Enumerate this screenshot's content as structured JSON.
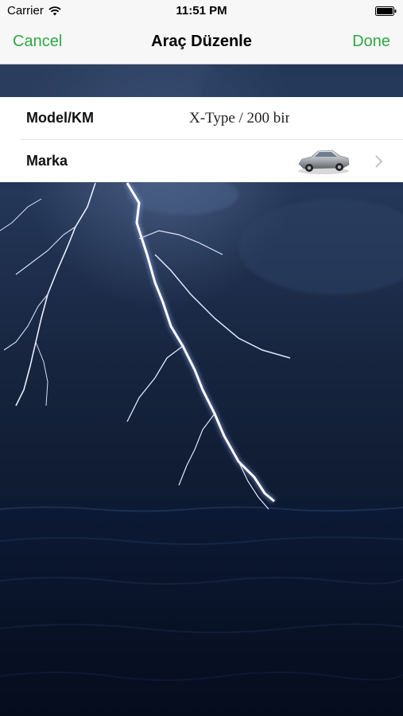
{
  "status_bar": {
    "carrier": "Carrier",
    "time": "11:51 PM",
    "icons": [
      "wifi-icon",
      "battery-icon"
    ]
  },
  "nav": {
    "cancel_label": "Cancel",
    "title": "Araç Düzenle",
    "done_label": "Done",
    "accent_color": "#2fa845"
  },
  "form": {
    "rows": [
      {
        "label": "Model/KM",
        "value": "X-Type / 200 bin"
      },
      {
        "label": "Marka",
        "icon": "car-thumbnail",
        "accessory": "chevron-right-icon"
      }
    ]
  },
  "background": {
    "image": "lightning-storm-over-sea"
  }
}
